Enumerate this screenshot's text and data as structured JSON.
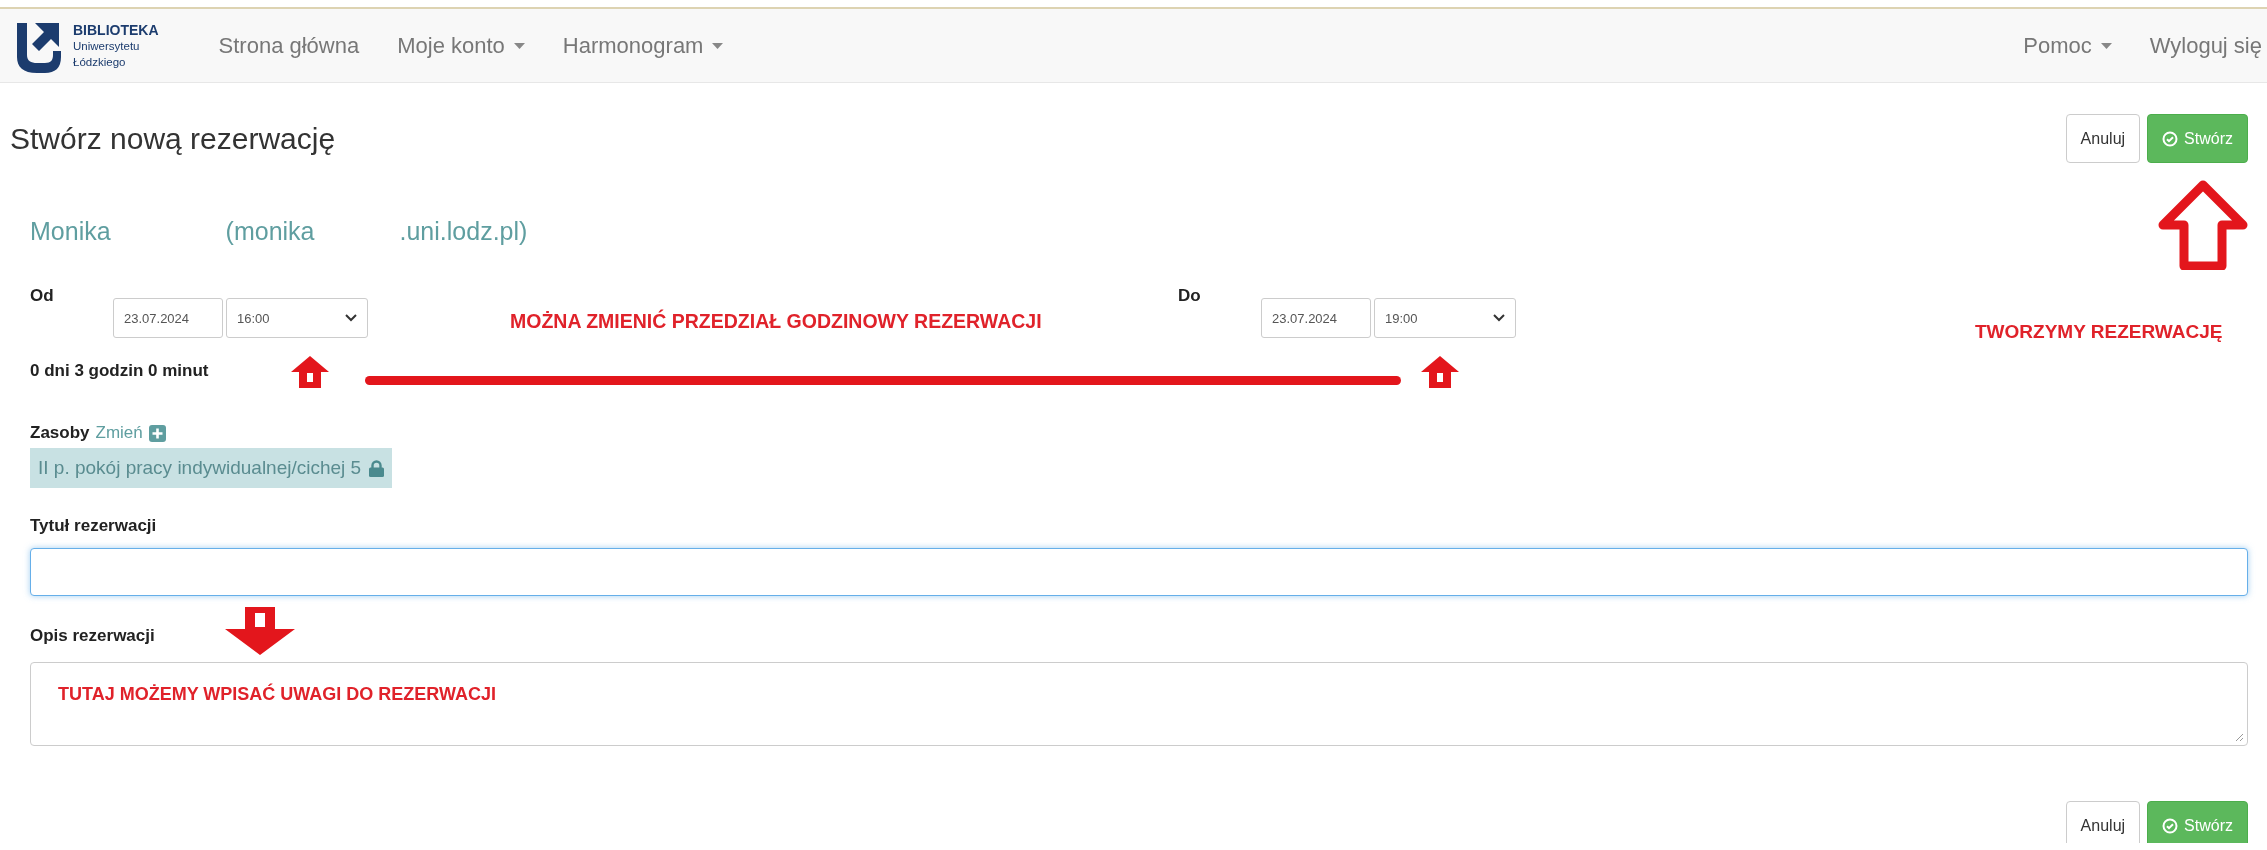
{
  "navbar": {
    "logo": [
      "BIBLIOTEKA",
      "Uniwersytetu",
      "Łódzkiego"
    ],
    "left_items": [
      {
        "label": "Strona główna",
        "dropdown": false
      },
      {
        "label": "Moje konto",
        "dropdown": true
      },
      {
        "label": "Harmonogram",
        "dropdown": true
      }
    ],
    "right_items": [
      {
        "label": "Pomoc",
        "dropdown": true
      },
      {
        "label": "Wyloguj się",
        "dropdown": false
      }
    ]
  },
  "page_title": "Stwórz nową rezerwację",
  "header_buttons": [
    {
      "label": "Anuluj",
      "kind": "default"
    },
    {
      "label": "Stwórz",
      "kind": "primary"
    }
  ],
  "user": [
    "Monika",
    "(monika",
    ".uni.lodz.pl)"
  ],
  "from": {
    "label": "Od",
    "date": "23.07.2024",
    "time": "16:00"
  },
  "to": {
    "label": "Do",
    "date": "23.07.2024",
    "time": "19:00"
  },
  "duration": "0 dni 3 godzin 0 minut",
  "resources": {
    "label": "Zasoby",
    "change_link": "Zmień",
    "items": [
      {
        "name": "II p. pokój pracy indywidualnej/cichej 5",
        "locked": true
      }
    ]
  },
  "title_field": {
    "label": "Tytuł rezerwacji"
  },
  "description_field": {
    "label": "Opis rezerwacji"
  },
  "footer_buttons": [
    {
      "label": "Anuluj",
      "kind": "default"
    },
    {
      "label": "Stwórz",
      "kind": "primary"
    }
  ],
  "annotations": [
    {
      "kind": "time-range",
      "text": "MOŻNA ZMIENIĆ PRZEDZIAŁ GODZINOWY REZERWACJI"
    },
    {
      "kind": "create",
      "text": "TWORZYMY REZERWACJĘ"
    },
    {
      "kind": "description",
      "text": "TUTAJ MOŻEMY WPISAĆ UWAGI DO REZERWACJI"
    }
  ]
}
